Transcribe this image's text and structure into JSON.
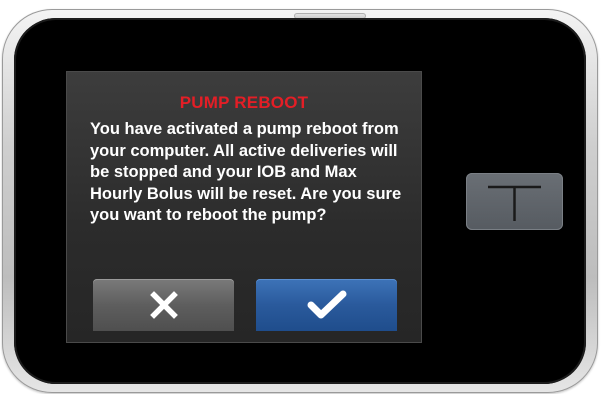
{
  "dialog": {
    "title": "PUMP REBOOT",
    "message": "You have activated a pump reboot from your computer. All active deliveries will be stopped and your IOB and Max Hourly Bolus will be reset. Are you sure you want to reboot the pump?",
    "cancel_icon": "x-icon",
    "confirm_icon": "checkmark-icon"
  },
  "device": {
    "home_button_icon": "t-logo-icon"
  },
  "colors": {
    "title_red": "#e41e26",
    "confirm_blue": "#2a5a9c",
    "cancel_gray": "#5e5e5e"
  }
}
